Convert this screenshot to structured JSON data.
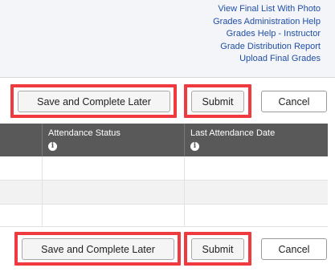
{
  "links": [
    "View Final List With Photo",
    "Grades Administration Help",
    "Grades Help - Instructor",
    "Grade Distribution Report",
    "Upload Final Grades"
  ],
  "top_actions": {
    "save_later": "Save and Complete Later",
    "submit": "Submit",
    "cancel": "Cancel"
  },
  "table": {
    "columns": [
      "",
      "Attendance Status",
      "Last Attendance Date"
    ],
    "row_count": 3
  },
  "bottom_actions": {
    "save_later": "Save and Complete Later",
    "submit": "Submit",
    "cancel": "Cancel"
  },
  "colors": {
    "highlight": "#ef3b40",
    "link": "#1f4ea8",
    "header_bg": "#595959"
  },
  "icons": [
    "info-icon"
  ]
}
